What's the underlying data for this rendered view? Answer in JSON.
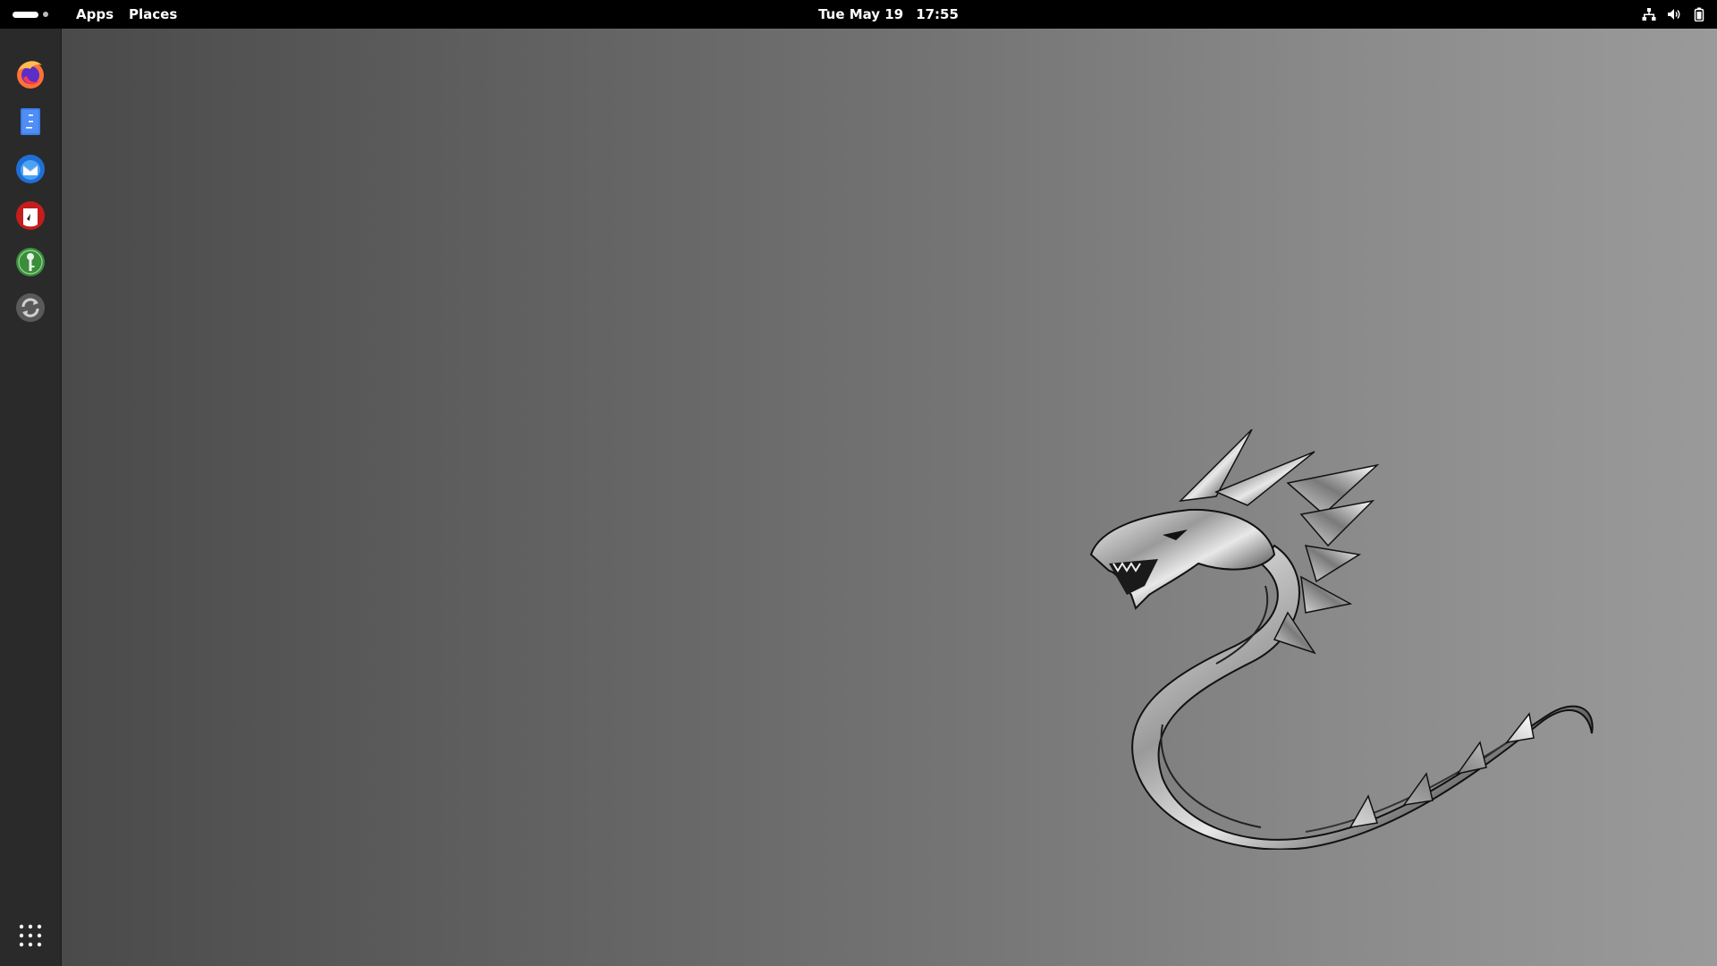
{
  "topbar": {
    "menus": {
      "apps": "Apps",
      "places": "Places"
    },
    "clock": {
      "date": "Tue May 19",
      "time": "17:55"
    },
    "tray_icons": [
      "network-icon",
      "volume-icon",
      "battery-icon"
    ]
  },
  "dock": {
    "items": [
      {
        "icon": "firefox-icon"
      },
      {
        "icon": "text-editor-icon"
      },
      {
        "icon": "thunderbird-icon"
      },
      {
        "icon": "red-app-icon"
      },
      {
        "icon": "green-key-app-icon"
      },
      {
        "icon": "software-updater-icon"
      }
    ],
    "show_apps_icon": "app-grid-icon"
  },
  "wallpaper": {
    "image": "dragon-logo",
    "colors": {
      "gradient_left": "#474747",
      "gradient_right": "#9a9a9a"
    }
  }
}
